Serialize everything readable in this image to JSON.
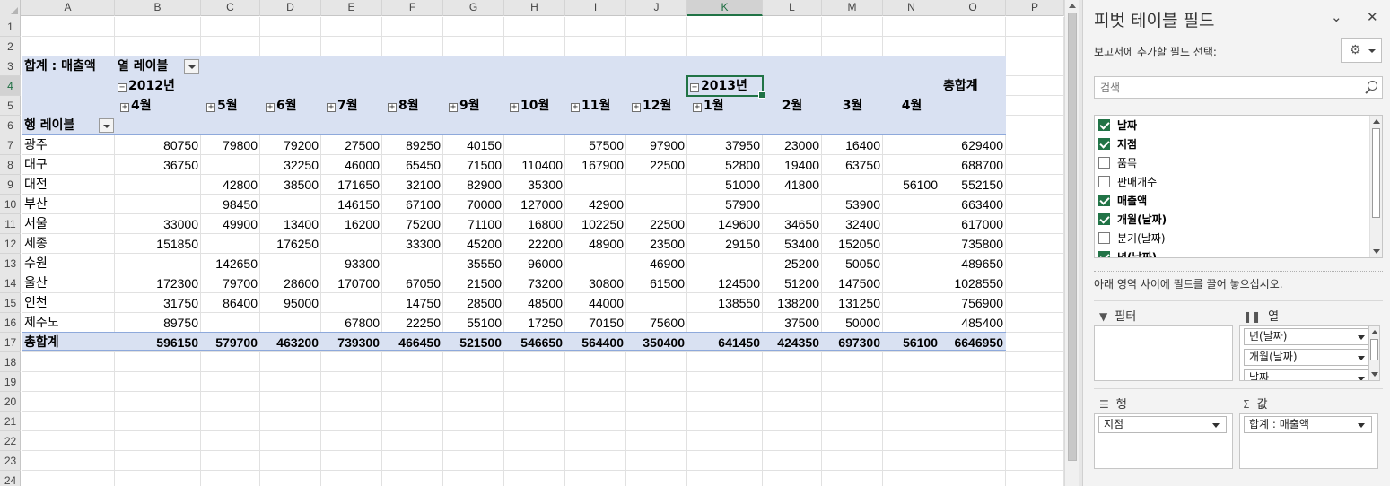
{
  "sheet": {
    "columns": [
      "A",
      "B",
      "C",
      "D",
      "E",
      "F",
      "G",
      "H",
      "I",
      "J",
      "K",
      "L",
      "M",
      "N",
      "O",
      "P"
    ],
    "rows": [
      "1",
      "2",
      "3",
      "4",
      "5",
      "6",
      "7",
      "8",
      "9",
      "10",
      "11",
      "12",
      "13",
      "14",
      "15",
      "16",
      "17",
      "18",
      "19",
      "20",
      "21",
      "22",
      "23",
      "24"
    ],
    "active_column": "K",
    "active_row": "4"
  },
  "pivot": {
    "value_label": "합계 : 매출액",
    "column_labels": "열 레이블",
    "row_labels": "행 레이블",
    "year_2012": "2012년",
    "year_2013": "2013년",
    "grand_total_header": "총합계",
    "months": [
      "4월",
      "5월",
      "6월",
      "7월",
      "8월",
      "9월",
      "10월",
      "11월",
      "12월",
      "1월",
      "2월",
      "3월",
      "4월"
    ],
    "month_toggles": [
      true,
      true,
      true,
      true,
      true,
      true,
      true,
      true,
      true,
      true,
      false,
      false,
      false
    ],
    "toggle_collapsed": "⊞",
    "toggle_expanded": "⊟",
    "rows": [
      {
        "label": "광주",
        "values": [
          "80750",
          "79800",
          "79200",
          "27500",
          "89250",
          "40150",
          "",
          "57500",
          "97900",
          "37950",
          "23000",
          "16400",
          ""
        ],
        "total": "629400"
      },
      {
        "label": "대구",
        "values": [
          "36750",
          "",
          "32250",
          "46000",
          "65450",
          "71500",
          "110400",
          "167900",
          "22500",
          "52800",
          "19400",
          "63750",
          ""
        ],
        "total": "688700"
      },
      {
        "label": "대전",
        "values": [
          "",
          "42800",
          "38500",
          "171650",
          "32100",
          "82900",
          "35300",
          "",
          "",
          "51000",
          "41800",
          "",
          "56100"
        ],
        "total": "552150"
      },
      {
        "label": "부산",
        "values": [
          "",
          "98450",
          "",
          "146150",
          "67100",
          "70000",
          "127000",
          "42900",
          "",
          "57900",
          "",
          "53900",
          ""
        ],
        "total": "663400"
      },
      {
        "label": "서울",
        "values": [
          "33000",
          "49900",
          "13400",
          "16200",
          "75200",
          "71100",
          "16800",
          "102250",
          "22500",
          "149600",
          "34650",
          "32400",
          ""
        ],
        "total": "617000"
      },
      {
        "label": "세종",
        "values": [
          "151850",
          "",
          "176250",
          "",
          "33300",
          "45200",
          "22200",
          "48900",
          "23500",
          "29150",
          "53400",
          "152050",
          ""
        ],
        "total": "735800"
      },
      {
        "label": "수원",
        "values": [
          "",
          "142650",
          "",
          "93300",
          "",
          "35550",
          "96000",
          "",
          "46900",
          "",
          "25200",
          "50050",
          ""
        ],
        "total": "489650"
      },
      {
        "label": "울산",
        "values": [
          "172300",
          "79700",
          "28600",
          "170700",
          "67050",
          "21500",
          "73200",
          "30800",
          "61500",
          "124500",
          "51200",
          "147500",
          ""
        ],
        "total": "1028550"
      },
      {
        "label": "인천",
        "values": [
          "31750",
          "86400",
          "95000",
          "",
          "14750",
          "28500",
          "48500",
          "44000",
          "",
          "138550",
          "138200",
          "131250",
          ""
        ],
        "total": "756900"
      },
      {
        "label": "제주도",
        "values": [
          "89750",
          "",
          "",
          "67800",
          "22250",
          "55100",
          "17250",
          "70150",
          "75600",
          "",
          "37500",
          "50000",
          ""
        ],
        "total": "485400"
      }
    ],
    "grand_total": {
      "label": "총합계",
      "values": [
        "596150",
        "579700",
        "463200",
        "739300",
        "466450",
        "521500",
        "546650",
        "564400",
        "350400",
        "641450",
        "424350",
        "697300",
        "56100"
      ],
      "total": "6646950"
    }
  },
  "pane": {
    "title": "피벗 테이블 필드",
    "choose_fields_label": "보고서에 추가할 필드 선택:",
    "search_placeholder": "검색",
    "fields": [
      {
        "label": "날짜",
        "checked": true
      },
      {
        "label": "지점",
        "checked": true
      },
      {
        "label": "품목",
        "checked": false
      },
      {
        "label": "판매개수",
        "checked": false
      },
      {
        "label": "매출액",
        "checked": true
      },
      {
        "label": "개월(날짜)",
        "checked": true
      },
      {
        "label": "분기(날짜)",
        "checked": false
      },
      {
        "label": "년(날짜)",
        "checked": true
      }
    ],
    "drag_hint": "아래 영역 사이에 필드를 끌어 놓으십시오.",
    "areas": {
      "filter": {
        "title": "필터",
        "items": []
      },
      "columns": {
        "title": "열",
        "items": [
          "년(날짜)",
          "개월(날짜)",
          "날짜"
        ]
      },
      "rows": {
        "title": "행",
        "items": [
          "지점"
        ]
      },
      "values": {
        "title": "값",
        "items": [
          "합계 : 매출액"
        ]
      }
    }
  }
}
